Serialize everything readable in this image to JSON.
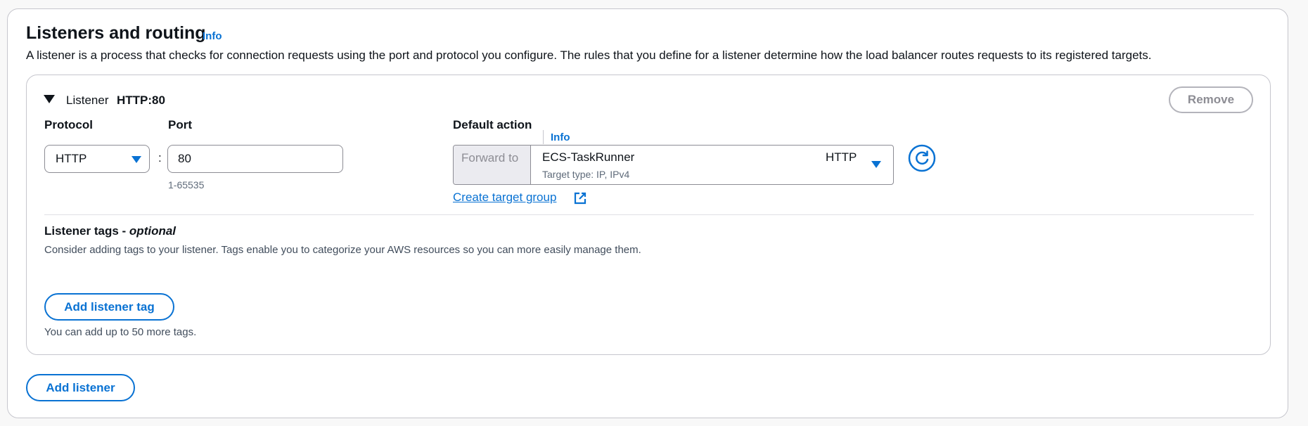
{
  "section": {
    "title": "Listeners and routing",
    "info": "Info",
    "description": "A listener is a process that checks for connection requests using the port and protocol you configure. The rules that you define for a listener determine how the load balancer routes requests to its registered targets."
  },
  "listener": {
    "label": "Listener",
    "name": "HTTP:80",
    "remove_label": "Remove",
    "protocol": {
      "label": "Protocol",
      "value": "HTTP"
    },
    "port": {
      "label": "Port",
      "value": "80",
      "hint": "1-65535"
    },
    "default_action": {
      "label": "Default action",
      "info": "Info",
      "forward_label": "Forward to",
      "target_name": "ECS-TaskRunner",
      "target_protocol": "HTTP",
      "target_subtext": "Target type: IP, IPv4",
      "create_link": "Create target group"
    },
    "tags": {
      "title": "Listener tags - ",
      "title_optional": "optional",
      "description": "Consider adding tags to your listener. Tags enable you to categorize your AWS resources so you can more easily manage them.",
      "add_label": "Add listener tag",
      "hint": "You can add up to 50 more tags."
    }
  },
  "add_listener_label": "Add listener",
  "icons": {
    "collapse": "caret-down-icon",
    "select": "triangle-down-icon",
    "refresh": "refresh-icon",
    "external": "external-link-icon"
  },
  "colors": {
    "accent": "#0972d3",
    "text": "#0f141a",
    "border": "#c6c6cd",
    "muted": "#5f6b7a"
  }
}
